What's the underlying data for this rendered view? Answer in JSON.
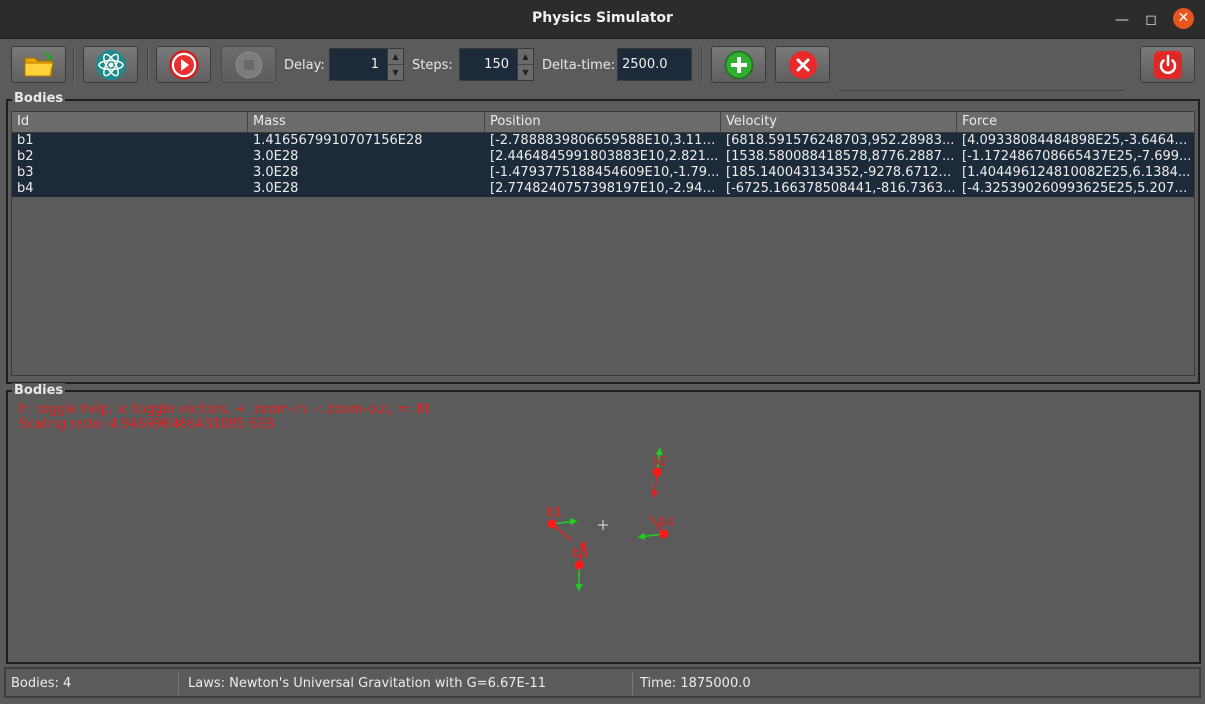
{
  "window": {
    "title": "Physics Simulator"
  },
  "toolbar": {
    "delay_label": "Delay:",
    "delay_value": "1",
    "steps_label": "Steps:",
    "steps_value": "150",
    "dt_label": "Delta-time:",
    "dt_value": "2500.0"
  },
  "bodies_table": {
    "title": "Bodies",
    "columns": [
      "Id",
      "Mass",
      "Position",
      "Velocity",
      "Force"
    ],
    "rows": [
      [
        "b1",
        "1.4165679910707156E28",
        "[-2.7888839806659588E10,3.118...",
        "[6818.591576248703,952.28983...",
        "[4.09338084484898E25,-3.64647..."
      ],
      [
        "b2",
        "3.0E28",
        "[2.4464845991803883E10,2.821...",
        "[1538.580088418578,8776.2887...",
        "[-1.172486708665437E25,-7.699..."
      ],
      [
        "b3",
        "3.0E28",
        "[-1.4793775188454609E10,-1.79...",
        "[185.140043134352,-9278.67124...",
        "[1.404496124810082E25,6.1384..."
      ],
      [
        "b4",
        "3.0E28",
        "[2.7748240757398197E10,-2.940...",
        "[-6725.166378508441,-816.7363...",
        "[-4.325390260993625E25,5.2073..."
      ]
    ]
  },
  "viewer": {
    "title": "Bodies",
    "help_line": "h: toggle help, v: toggle vectors, +: zoom-in, -: zoom-out, =: fit",
    "scale_line": "Scaling ratio: 4.946996466431095 6E8",
    "labels": {
      "b1": "b1",
      "b2": "b2",
      "b3": "b3",
      "b4": "b4"
    }
  },
  "statusbar": {
    "bodies": "Bodies: 4",
    "laws": "Laws: Newton's Universal Gravitation with G=6.67E-11",
    "time": "Time: 1875000.0"
  },
  "colors": {
    "body": "#ff1a1a",
    "velocity": "#22cc22",
    "force": "#e02020",
    "selection": "#1c2a3a"
  }
}
